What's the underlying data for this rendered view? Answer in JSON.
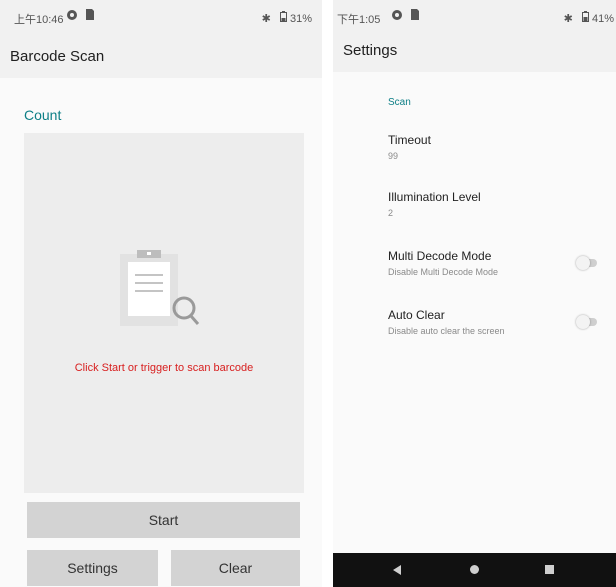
{
  "left_screen": {
    "status_bar": {
      "time": "上午10:46",
      "icons": [
        "gear-icon",
        "sim-icon"
      ],
      "bluetooth": "✱",
      "battery": "31%"
    },
    "app_bar": {
      "title": "Barcode Scan"
    },
    "count_label": "Count",
    "scan_hint": "Click Start or trigger to scan barcode",
    "buttons": {
      "start": "Start",
      "settings": "Settings",
      "clear": "Clear"
    },
    "colors": {
      "accent": "#0d7f86",
      "hint": "#d82020",
      "button": "#d3d3d3"
    }
  },
  "right_screen": {
    "status_bar": {
      "time": "下午1:05",
      "icons": [
        "gear-icon",
        "sim-icon"
      ],
      "bluetooth": "✱",
      "battery": "41%"
    },
    "app_bar": {
      "title": "Settings"
    },
    "category": "Scan",
    "prefs": [
      {
        "title": "Timeout",
        "summary": "99"
      },
      {
        "title": "Illumination Level",
        "summary": "2"
      },
      {
        "title": "Multi Decode Mode",
        "summary": "Disable Multi Decode Mode",
        "toggle": false
      },
      {
        "title": "Auto Clear",
        "summary": "Disable auto clear the screen",
        "toggle": false
      }
    ],
    "nav_bar": [
      "back-icon",
      "home-icon",
      "recents-icon"
    ]
  }
}
